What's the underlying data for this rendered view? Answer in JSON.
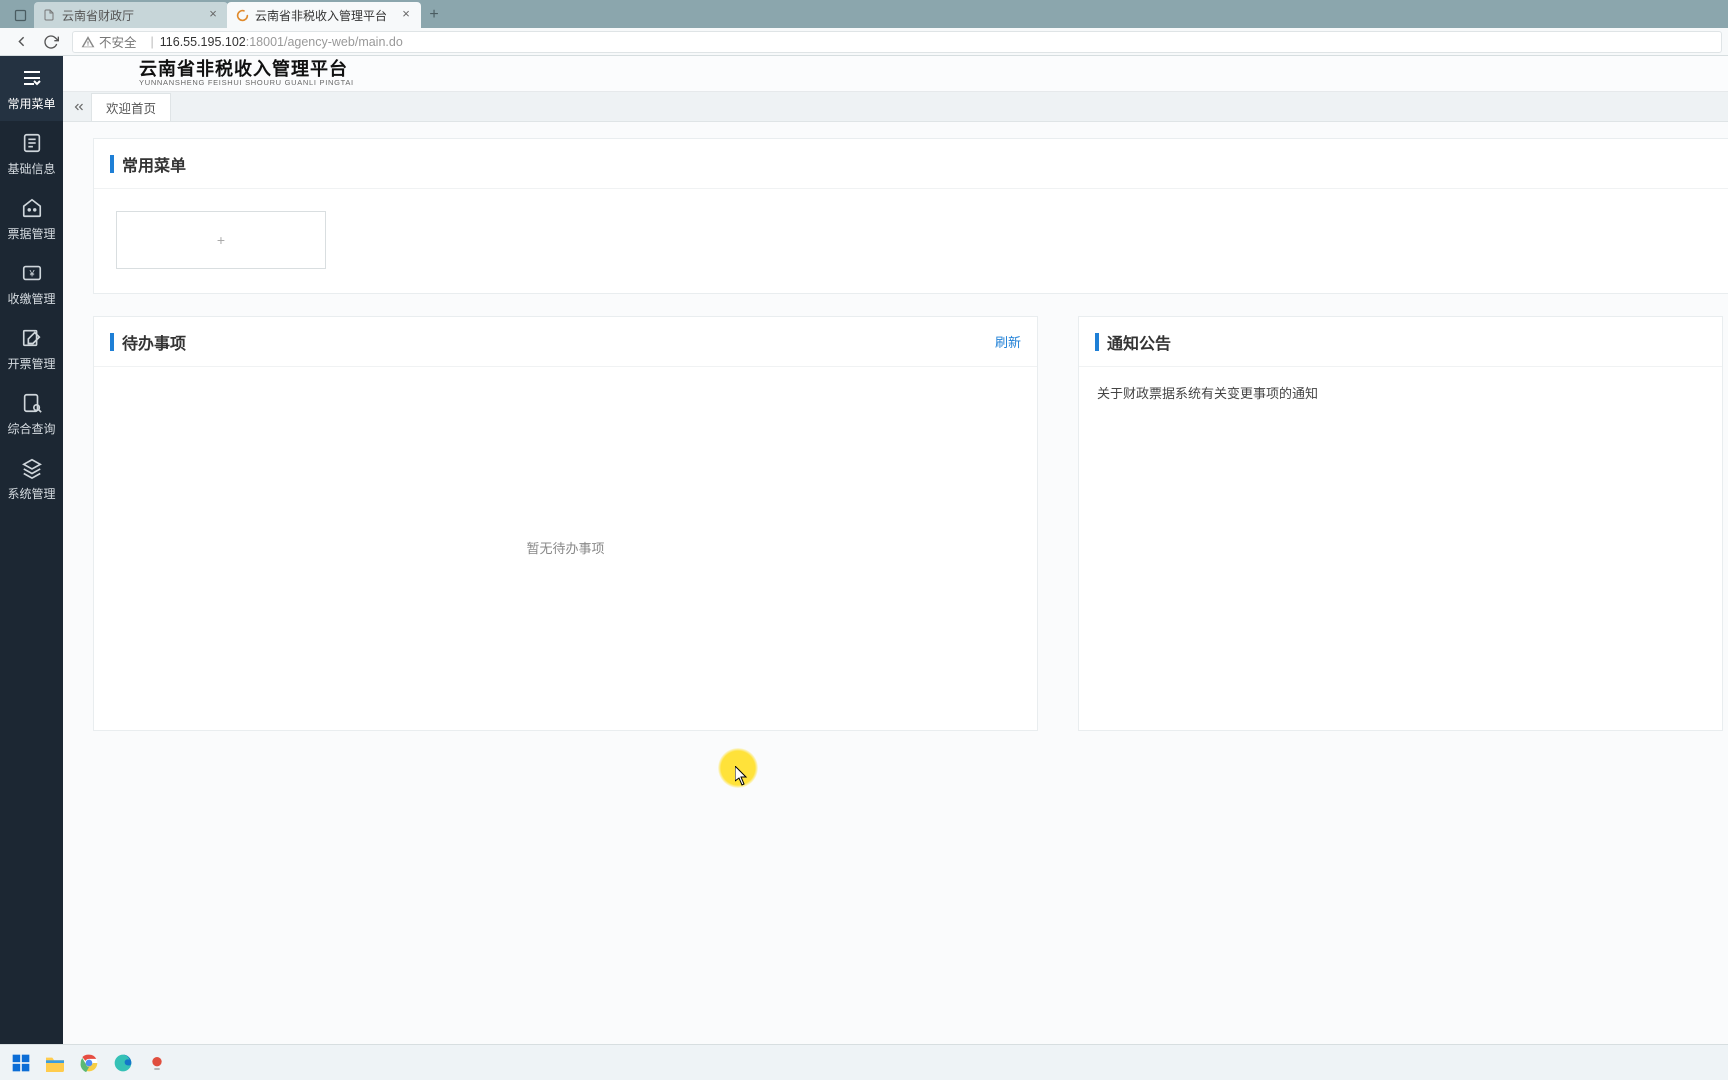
{
  "browser": {
    "tabs": [
      {
        "title": "云南省财政厅",
        "active": false
      },
      {
        "title": "云南省非税收入管理平台",
        "active": true
      }
    ],
    "security_label": "不安全",
    "url_host": "116.55.195.102",
    "url_rest": ":18001/agency-web/main.do"
  },
  "app": {
    "title_cn": "云南省非税收入管理平台",
    "title_en": "YUNNANSHENG FEISHUI SHOURU GUANLI PINGTAI"
  },
  "sidebar": {
    "items": [
      {
        "label": "常用菜单",
        "icon": "list-icon"
      },
      {
        "label": "基础信息",
        "icon": "doc-icon"
      },
      {
        "label": "票据管理",
        "icon": "house-icon"
      },
      {
        "label": "收缴管理",
        "icon": "money-icon"
      },
      {
        "label": "开票管理",
        "icon": "edit-icon"
      },
      {
        "label": "综合查询",
        "icon": "search-doc-icon"
      },
      {
        "label": "系统管理",
        "icon": "layers-icon"
      }
    ]
  },
  "page_tabs": {
    "items": [
      {
        "label": "欢迎首页"
      }
    ]
  },
  "panels": {
    "common_title": "常用菜单",
    "add_label": "+",
    "todo_title": "待办事项",
    "todo_refresh": "刷新",
    "todo_empty": "暂无待办事项",
    "notice_title": "通知公告",
    "notice_items": [
      "关于财政票据系统有关变更事项的通知"
    ]
  }
}
